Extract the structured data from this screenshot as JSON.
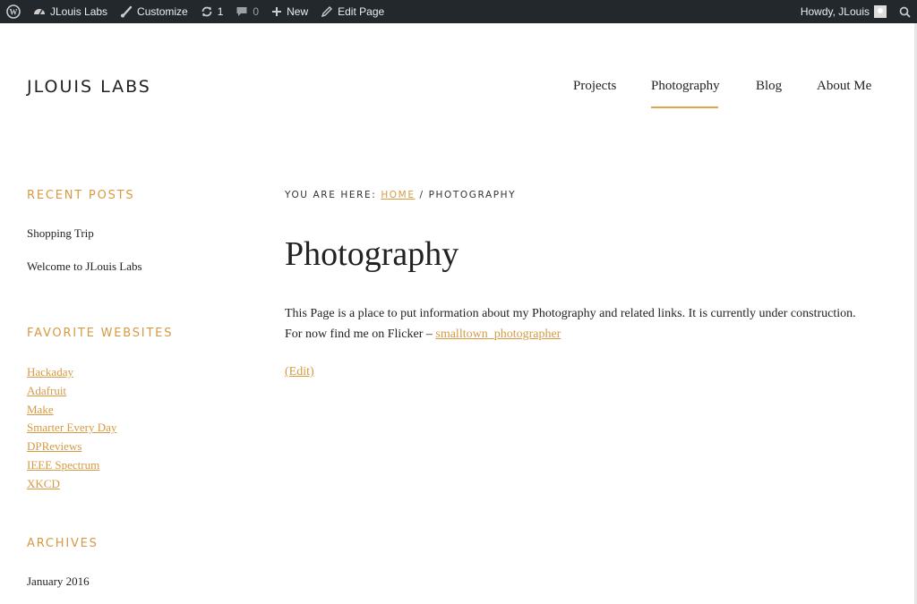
{
  "adminbar": {
    "site_name": "JLouis Labs",
    "customize": "Customize",
    "updates_count": "1",
    "comments_count": "0",
    "new_label": "New",
    "edit_page": "Edit Page",
    "howdy": "Howdy, JLouis",
    "icons": [
      "wordpress-logo-icon",
      "dashboard-icon",
      "brush-icon",
      "refresh-icon",
      "comment-icon",
      "plus-icon",
      "pencil-icon",
      "avatar",
      "search-icon"
    ]
  },
  "header": {
    "site_title": "JLOUIS LABS",
    "nav": [
      "Projects",
      "Photography",
      "Blog",
      "About Me"
    ],
    "active_nav": "Photography",
    "accent_color": "#d69a43"
  },
  "sidebar": {
    "recent_posts_title": "RECENT POSTS",
    "recent_posts": [
      "Shopping Trip",
      "Welcome to JLouis Labs"
    ],
    "favorites_title": "FAVORITE WEBSITES",
    "favorites": [
      "Hackaday",
      "Adafruit",
      "Make",
      "Smarter Every Day",
      "DPReviews",
      "IEEE Spectrum",
      "XKCD"
    ],
    "archives_title": "ARCHIVES",
    "archives": [
      "January 2016"
    ]
  },
  "main": {
    "breadcrumb_prefix": "YOU ARE HERE: ",
    "breadcrumb_home": "HOME",
    "breadcrumb_sep": " / ",
    "breadcrumb_current": "PHOTOGRAPHY",
    "page_title": "Photography",
    "paragraph_1": "This Page is a place to put information about my Photography and related links. It is currently under construction.",
    "paragraph_2_prefix": "For now find me on Flicker – ",
    "flickr_link": "smalltown_photographer",
    "edit_link": "(Edit)"
  }
}
